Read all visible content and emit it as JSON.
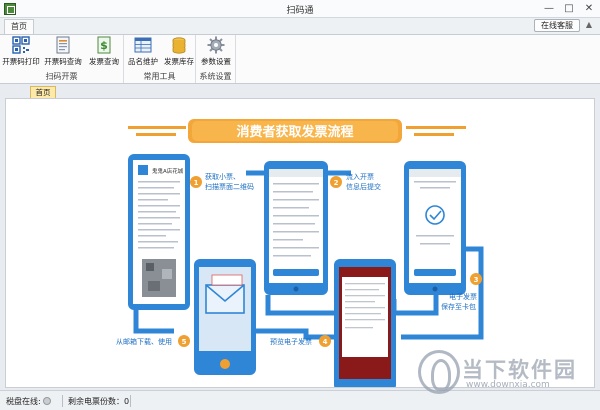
{
  "window": {
    "title": "扫码通"
  },
  "ribbon": {
    "tab_home": "首页",
    "online_service": "在线客服",
    "groups": [
      {
        "label": "扫码开票",
        "buttons": [
          "开票码打印",
          "开票码查询",
          "发票查询"
        ]
      },
      {
        "label": "常用工具",
        "buttons": [
          "品名维护",
          "发票库存"
        ]
      },
      {
        "label": "系统设置",
        "buttons": [
          "参数设置"
        ]
      }
    ]
  },
  "doc_tab": {
    "label": "首页"
  },
  "flow": {
    "title": "消费者获取发票流程",
    "steps": [
      {
        "num": "1",
        "line1": "获取小票、",
        "line2": "扫描票面二维码"
      },
      {
        "num": "2",
        "line1": "流入开票",
        "line2": "信息后提交"
      },
      {
        "num": "3",
        "line1": "电子发票",
        "line2": "保存至卡包"
      },
      {
        "num": "4",
        "line1": "预览电子发票",
        "line2": ""
      },
      {
        "num": "5",
        "line1": "从邮箱下载、使用",
        "line2": ""
      }
    ],
    "receipt_store": "鬼鬼A店花城"
  },
  "status": {
    "disk_online_label": "税盘在线:",
    "remaining_label": "剩余电票份数：",
    "remaining_value": "0"
  },
  "watermark": {
    "title": "当下软件园",
    "url": "www.downxia.com"
  },
  "colors": {
    "accent_orange": "#f0a030",
    "flow_blue": "#2f86d6",
    "ribbon_bg": "#fbfbfc"
  }
}
